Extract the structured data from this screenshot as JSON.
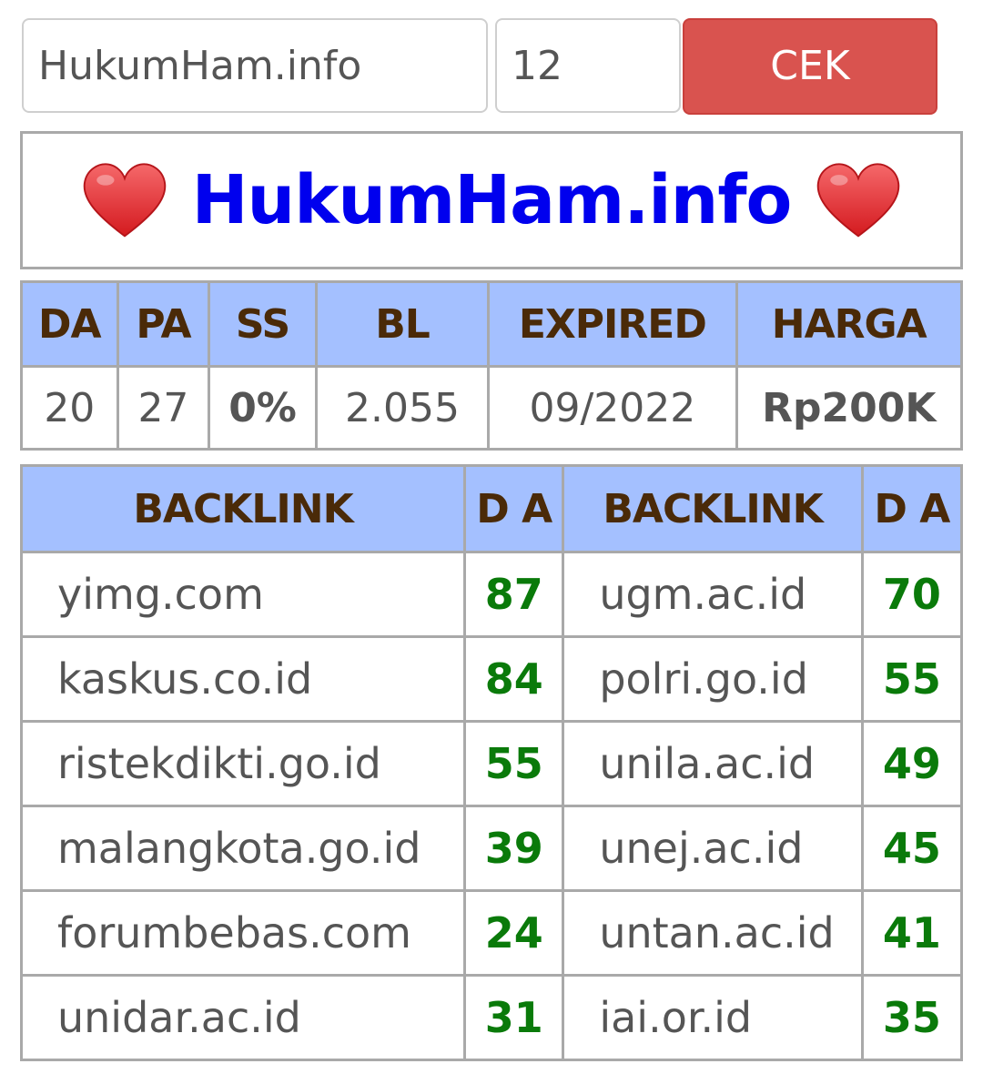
{
  "form": {
    "domain_value": "HukumHam.info",
    "count_value": "12",
    "check_label": "CEK",
    "button_color": "#d9534f"
  },
  "title": {
    "domain": "HukumHam.info",
    "decor_icon": "heart-icon",
    "domain_color": "#0000ee"
  },
  "metrics": {
    "headers": [
      "DA",
      "PA",
      "SS",
      "BL",
      "EXPIRED",
      "HARGA"
    ],
    "values": [
      "20",
      "27",
      "0%",
      "2.055",
      "09/2022",
      "Rp200K"
    ],
    "header_bg": "#a4c0ff",
    "ss_color": "#0a8a0a",
    "price_color": "#ee0000"
  },
  "backlinks": {
    "headers": [
      "BACKLINK",
      "D A",
      "BACKLINK",
      "D A"
    ],
    "rows": [
      {
        "left": "yimg.com",
        "left_da": "87",
        "right": "ugm.ac.id",
        "right_da": "70"
      },
      {
        "left": "kaskus.co.id",
        "left_da": "84",
        "right": "polri.go.id",
        "right_da": "55"
      },
      {
        "left": "ristekdikti.go.id",
        "left_da": "55",
        "right": "unila.ac.id",
        "right_da": "49"
      },
      {
        "left": "malangkota.go.id",
        "left_da": "39",
        "right": "unej.ac.id",
        "right_da": "45"
      },
      {
        "left": "forumbebas.com",
        "left_da": "24",
        "right": "untan.ac.id",
        "right_da": "41"
      },
      {
        "left": "unidar.ac.id",
        "left_da": "31",
        "right": "iai.or.id",
        "right_da": "35"
      }
    ],
    "da_color": "#0a7a0a"
  }
}
